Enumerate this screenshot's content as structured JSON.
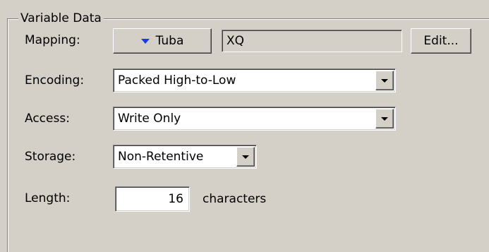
{
  "group": {
    "title": "Variable Data"
  },
  "mapping": {
    "label": "Mapping:",
    "button_label": "Tuba",
    "value": "XQ",
    "edit_label": "Edit..."
  },
  "encoding": {
    "label": "Encoding:",
    "selected": "Packed High-to-Low"
  },
  "access": {
    "label": "Access:",
    "selected": "Write Only"
  },
  "storage": {
    "label": "Storage:",
    "selected": "Non-Retentive"
  },
  "length": {
    "label": "Length:",
    "value": "16",
    "units": "characters"
  },
  "icons": {
    "mapping_button": "chevron-down-icon",
    "dropdowns": "dropdown-arrow-icon"
  },
  "colors": {
    "background": "#d4d0c8",
    "mapping_arrow": "#1a3ae8"
  }
}
